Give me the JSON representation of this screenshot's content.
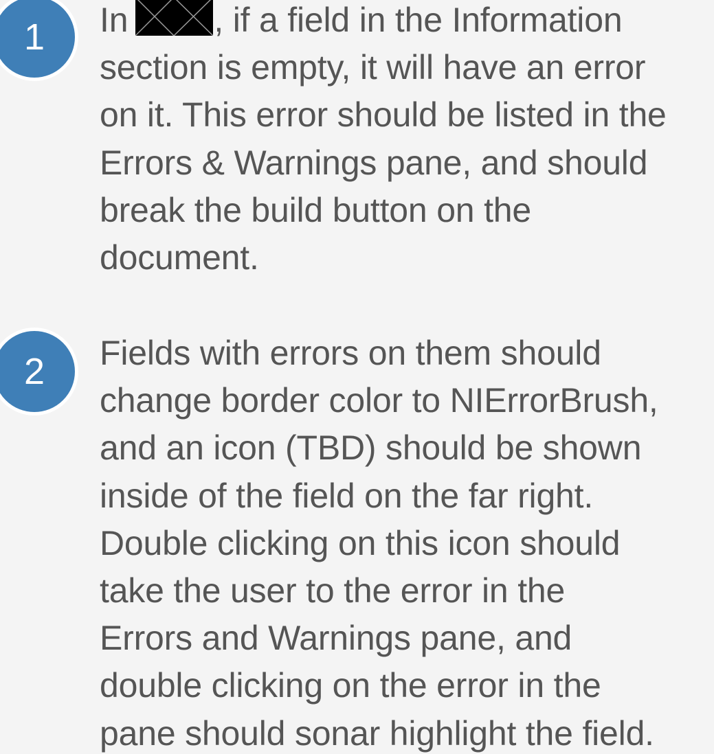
{
  "steps": [
    {
      "number": "1",
      "lines": {
        "l1_before": "In",
        "l1_after": ", if a field in the Information",
        "l2": "section is empty, it will have an error",
        "l3": "on it. This error should be listed in the",
        "l4": "Errors & Warnings pane, and should",
        "l5": "break the build button on the",
        "l6": "document."
      }
    },
    {
      "number": "2",
      "lines": {
        "l1": "Fields with errors on them should",
        "l2": "change border color to NIErrorBrush,",
        "l3": "and an icon (TBD) should be shown",
        "l4": "inside of the field on the far right.",
        "l5": "Double clicking on this icon should",
        "l6": "take the user to the error in the",
        "l7": "Errors and Warnings pane, and",
        "l8": "double clicking on the error in the",
        "l9": "pane should sonar highlight the field."
      }
    }
  ],
  "colors": {
    "background": "#f4f4f4",
    "badge": "#3f7fb7",
    "text": "#555555",
    "redaction": "#000000"
  }
}
